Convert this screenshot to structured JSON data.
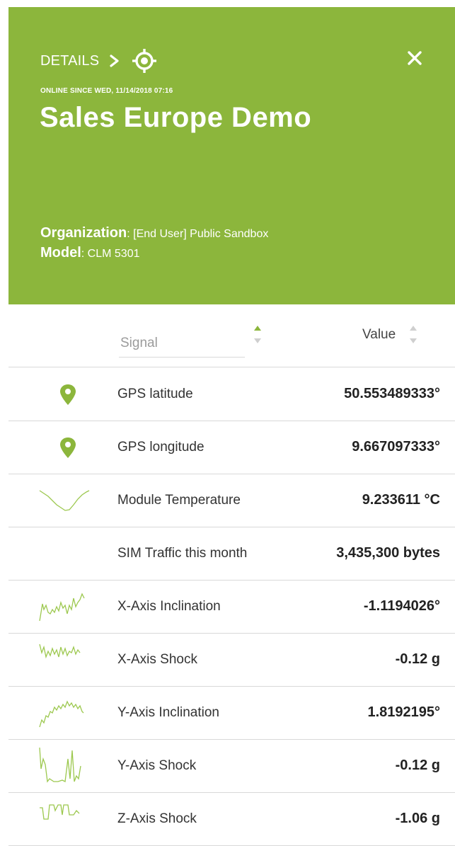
{
  "header": {
    "breadcrumb": "DETAILS",
    "online_since": "ONLINE SINCE WED, 11/14/2018 07:16",
    "title": "Sales Europe Demo",
    "organization_label": "Organization",
    "organization_value": ": [End User] Public Sandbox",
    "model_label": "Model",
    "model_value": ": CLM 5301",
    "bg_color": "#8cb63c"
  },
  "table": {
    "signal_placeholder": "Signal",
    "value_header": "Value",
    "rows": [
      {
        "name": "GPS latitude",
        "value": "50.553489333°",
        "icon": "map-pin-icon"
      },
      {
        "name": "GPS longitude",
        "value": "9.667097333°",
        "icon": "map-pin-icon"
      },
      {
        "name": "Module Temperature",
        "value": "9.233611 °C",
        "icon": "sparkline"
      },
      {
        "name": "SIM Traffic this month",
        "value": "3,435,300 bytes",
        "icon": "none"
      },
      {
        "name": "X-Axis Inclination",
        "value": "-1.1194026°",
        "icon": "sparkline"
      },
      {
        "name": "X-Axis Shock",
        "value": "-0.12 g",
        "icon": "sparkline"
      },
      {
        "name": "Y-Axis Inclination",
        "value": "1.8192195°",
        "icon": "sparkline"
      },
      {
        "name": "Y-Axis Shock",
        "value": "-0.12 g",
        "icon": "sparkline"
      },
      {
        "name": "Z-Axis Shock",
        "value": "-1.06 g",
        "icon": "sparkline"
      }
    ]
  }
}
